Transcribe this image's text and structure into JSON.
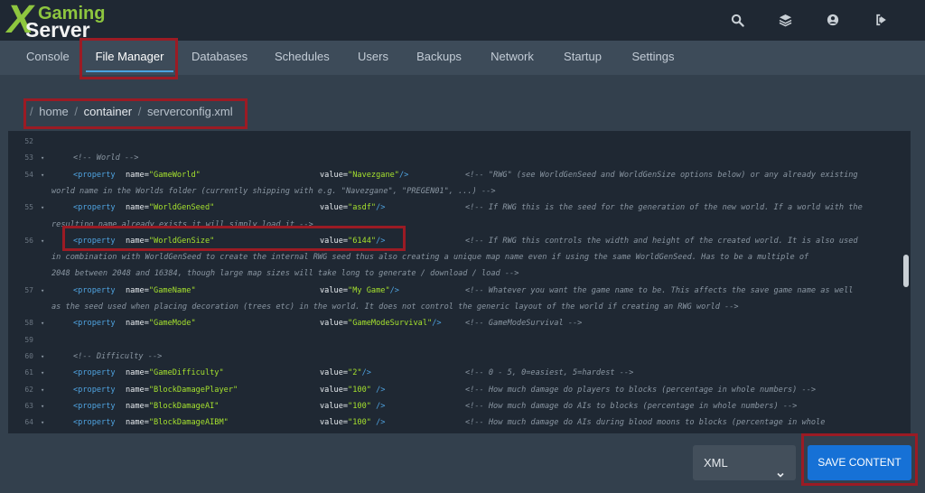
{
  "logo": {
    "x": "X",
    "line1": "Gaming",
    "line2": "Server"
  },
  "top_icons": [
    "search-icon",
    "layers-icon",
    "user-icon",
    "logout-icon"
  ],
  "tabs": [
    {
      "label": "Console"
    },
    {
      "label": "File Manager",
      "active": true
    },
    {
      "label": "Databases"
    },
    {
      "label": "Schedules"
    },
    {
      "label": "Users"
    },
    {
      "label": "Backups"
    },
    {
      "label": "Network"
    },
    {
      "label": "Startup"
    },
    {
      "label": "Settings"
    }
  ],
  "breadcrumb": {
    "sep": "/",
    "home": "home",
    "container": "container",
    "file": "serverconfig.xml"
  },
  "editor": {
    "lines": [
      {
        "n": "52",
        "fold": false,
        "parts": []
      },
      {
        "n": "53",
        "fold": true,
        "parts": [
          {
            "t": "<!-- World -->",
            "c": "cmt",
            "col": 0
          }
        ]
      },
      {
        "n": "54",
        "fold": true,
        "parts": [
          {
            "t": "<property",
            "c": "tag",
            "col": 0
          },
          {
            "t": "name=",
            "c": "attr",
            "col": 1
          },
          {
            "t": "\"GameWorld\"",
            "c": "str",
            "col": 1
          },
          {
            "t": "value=",
            "c": "attr",
            "col": 2
          },
          {
            "t": "\"Navezgane\"",
            "c": "str",
            "col": 2
          },
          {
            "t": "/>",
            "c": "tag",
            "col": 2
          },
          {
            "t": "<!-- \"RWG\" (see WorldGenSeed and WorldGenSize options below) or any already existing",
            "c": "cmt",
            "col": 3
          }
        ]
      },
      {
        "n": "",
        "fold": false,
        "parts": [
          {
            "t": "world name in the Worlds folder (currently shipping with e.g. \"Navezgane\", \"PREGEN01\", ...) -->",
            "c": "cmt",
            "col": -1
          }
        ]
      },
      {
        "n": "55",
        "fold": true,
        "parts": [
          {
            "t": "<property",
            "c": "tag",
            "col": 0
          },
          {
            "t": "name=",
            "c": "attr",
            "col": 1
          },
          {
            "t": "\"WorldGenSeed\"",
            "c": "str",
            "col": 1
          },
          {
            "t": "value=",
            "c": "attr",
            "col": 2
          },
          {
            "t": "\"asdf\"",
            "c": "str",
            "col": 2
          },
          {
            "t": "/>",
            "c": "tag",
            "col": 2
          },
          {
            "t": "<!-- If RWG this is the seed for the generation of the new world. If a world with the",
            "c": "cmt",
            "col": 3
          }
        ]
      },
      {
        "n": "",
        "fold": false,
        "parts": [
          {
            "t": "resulting name already exists it will simply load it -->",
            "c": "cmt",
            "col": -1
          }
        ]
      },
      {
        "n": "56",
        "fold": true,
        "parts": [
          {
            "t": "<property",
            "c": "tag",
            "col": 0
          },
          {
            "t": "name=",
            "c": "attr",
            "col": 1
          },
          {
            "t": "\"WorldGenSize\"",
            "c": "str",
            "col": 1
          },
          {
            "t": "value=",
            "c": "attr",
            "col": 2
          },
          {
            "t": "\"6144\"",
            "c": "str",
            "col": 2
          },
          {
            "t": "/>",
            "c": "tag",
            "col": 2
          },
          {
            "t": "<!-- If RWG this controls the width and height of the created world. It is also used",
            "c": "cmt",
            "col": 3
          }
        ]
      },
      {
        "n": "",
        "fold": false,
        "parts": [
          {
            "t": "in combination with WorldGenSeed to create the internal RWG seed thus also creating a unique map name even if using the same WorldGenSeed. Has to be a multiple of",
            "c": "cmt",
            "col": -1
          }
        ]
      },
      {
        "n": "",
        "fold": false,
        "parts": [
          {
            "t": "2048 between 2048 and 16384, though large map sizes will take long to generate / download / load -->",
            "c": "cmt",
            "col": -1
          }
        ]
      },
      {
        "n": "57",
        "fold": true,
        "parts": [
          {
            "t": "<property",
            "c": "tag",
            "col": 0
          },
          {
            "t": "name=",
            "c": "attr",
            "col": 1
          },
          {
            "t": "\"GameName\"",
            "c": "str",
            "col": 1
          },
          {
            "t": "value=",
            "c": "attr",
            "col": 2
          },
          {
            "t": "\"My Game\"",
            "c": "str",
            "col": 2
          },
          {
            "t": "/>",
            "c": "tag",
            "col": 2
          },
          {
            "t": "<!-- Whatever you want the game name to be. This affects the save game name as well",
            "c": "cmt",
            "col": 3
          }
        ]
      },
      {
        "n": "",
        "fold": false,
        "parts": [
          {
            "t": "as the seed used when placing decoration (trees etc) in the world. It does not control the generic layout of the world if creating an RWG world -->",
            "c": "cmt",
            "col": -1
          }
        ]
      },
      {
        "n": "58",
        "fold": true,
        "parts": [
          {
            "t": "<property",
            "c": "tag",
            "col": 0
          },
          {
            "t": "name=",
            "c": "attr",
            "col": 1
          },
          {
            "t": "\"GameMode\"",
            "c": "str",
            "col": 1
          },
          {
            "t": "value=",
            "c": "attr",
            "col": 2
          },
          {
            "t": "\"GameModeSurvival\"",
            "c": "str",
            "col": 2
          },
          {
            "t": "/>",
            "c": "tag",
            "col": 2
          },
          {
            "t": "<!-- GameModeSurvival -->",
            "c": "cmt",
            "col": 3
          }
        ]
      },
      {
        "n": "59",
        "fold": false,
        "parts": []
      },
      {
        "n": "60",
        "fold": true,
        "parts": [
          {
            "t": "<!-- Difficulty -->",
            "c": "cmt",
            "col": 0
          }
        ]
      },
      {
        "n": "61",
        "fold": true,
        "parts": [
          {
            "t": "<property",
            "c": "tag",
            "col": 0
          },
          {
            "t": "name=",
            "c": "attr",
            "col": 1
          },
          {
            "t": "\"GameDifficulty\"",
            "c": "str",
            "col": 1
          },
          {
            "t": "value=",
            "c": "attr",
            "col": 2
          },
          {
            "t": "\"2\"",
            "c": "str",
            "col": 2
          },
          {
            "t": "/>",
            "c": "tag",
            "col": 2
          },
          {
            "t": "<!-- 0 - 5, 0=easiest, 5=hardest -->",
            "c": "cmt",
            "col": 3
          }
        ]
      },
      {
        "n": "62",
        "fold": true,
        "parts": [
          {
            "t": "<property",
            "c": "tag",
            "col": 0
          },
          {
            "t": "name=",
            "c": "attr",
            "col": 1
          },
          {
            "t": "\"BlockDamagePlayer\"",
            "c": "str",
            "col": 1
          },
          {
            "t": "value=",
            "c": "attr",
            "col": 2
          },
          {
            "t": "\"100\"",
            "c": "str",
            "col": 2
          },
          {
            "t": " />",
            "c": "tag",
            "col": 2
          },
          {
            "t": "<!-- How much damage do players to blocks (percentage in whole numbers) -->",
            "c": "cmt",
            "col": 3
          }
        ]
      },
      {
        "n": "63",
        "fold": true,
        "parts": [
          {
            "t": "<property",
            "c": "tag",
            "col": 0
          },
          {
            "t": "name=",
            "c": "attr",
            "col": 1
          },
          {
            "t": "\"BlockDamageAI\"",
            "c": "str",
            "col": 1
          },
          {
            "t": "value=",
            "c": "attr",
            "col": 2
          },
          {
            "t": "\"100\"",
            "c": "str",
            "col": 2
          },
          {
            "t": " />",
            "c": "tag",
            "col": 2
          },
          {
            "t": "<!-- How much damage do AIs to blocks (percentage in whole numbers) -->",
            "c": "cmt",
            "col": 3
          }
        ]
      },
      {
        "n": "64",
        "fold": true,
        "parts": [
          {
            "t": "<property",
            "c": "tag",
            "col": 0
          },
          {
            "t": "name=",
            "c": "attr",
            "col": 1
          },
          {
            "t": "\"BlockDamageAIBM\"",
            "c": "str",
            "col": 1
          },
          {
            "t": "value=",
            "c": "attr",
            "col": 2
          },
          {
            "t": "\"100\"",
            "c": "str",
            "col": 2
          },
          {
            "t": " />",
            "c": "tag",
            "col": 2
          },
          {
            "t": "<!-- How much damage do AIs during blood moons to blocks (percentage in whole",
            "c": "cmt",
            "col": 3
          }
        ]
      }
    ]
  },
  "language_select": {
    "value": "XML"
  },
  "save_button": {
    "label": "SAVE CONTENT"
  },
  "colors": {
    "accent": "#1671d6",
    "highlight": "#9b1b24",
    "tag": "#4fa3e0",
    "string": "#a6e22e",
    "comment": "#8a96a2"
  }
}
